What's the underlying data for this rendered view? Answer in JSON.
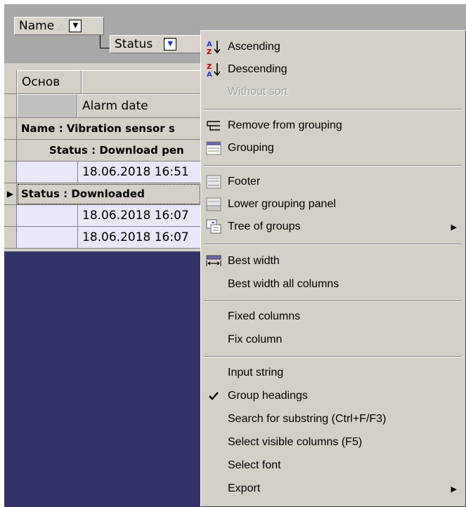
{
  "group_panel": {
    "chip_name": {
      "label": "Name",
      "sort_glyph": "△",
      "dropdown_glyph": "▼"
    },
    "chip_status": {
      "label": "Status",
      "sort_glyph": "/",
      "dropdown_glyph": "▼"
    }
  },
  "grid": {
    "band_header": "Основ",
    "column_header": "Alarm date",
    "rows": [
      {
        "kind": "group",
        "text": "Name : Vibration sensor s"
      },
      {
        "kind": "group",
        "text": "Status : Download pen"
      },
      {
        "kind": "data",
        "text": "18.06.2018 16:51"
      },
      {
        "kind": "group",
        "text": "Status : Downloaded"
      },
      {
        "kind": "data",
        "text": "18.06.2018 16:07"
      },
      {
        "kind": "data",
        "text": "18.06.2018 16:07"
      }
    ]
  },
  "context_menu": {
    "items": {
      "ascending": "Ascending",
      "descending": "Descending",
      "without_sort": "Without sort",
      "remove_grouping": "Remove from grouping",
      "grouping": "Grouping",
      "footer": "Footer",
      "lower_grouping_panel": "Lower grouping panel",
      "tree_of_groups": "Tree of groups",
      "best_width": "Best width",
      "best_width_all": "Best width all columns",
      "fixed_columns": "Fixed columns",
      "fix_column": "Fix column",
      "input_string": "Input string",
      "group_headings": "Group headings",
      "search_substring": "Search for substring (Ctrl+F/F3)",
      "select_visible_columns": "Select visible columns (F5)",
      "select_font": "Select font",
      "export": "Export"
    },
    "checked_item": "Group headings",
    "icons": {
      "ascending": "sort-az-icon",
      "descending": "sort-za-icon",
      "remove_grouping": "remove-grouping-icon",
      "grouping": "grouping-icon",
      "footer": "footer-icon",
      "lower_grouping_panel": "lower-panel-icon",
      "tree_of_groups": "tree-icon",
      "best_width": "best-width-icon",
      "group_headings": "checkmark-icon"
    }
  },
  "colors": {
    "background_dark": "#323269",
    "group_panel": "#a8a8a8",
    "menu_bg": "#d4d0c8",
    "data_row_bg": "#e9e8fb",
    "disabled_text": "#a0a0a0"
  }
}
